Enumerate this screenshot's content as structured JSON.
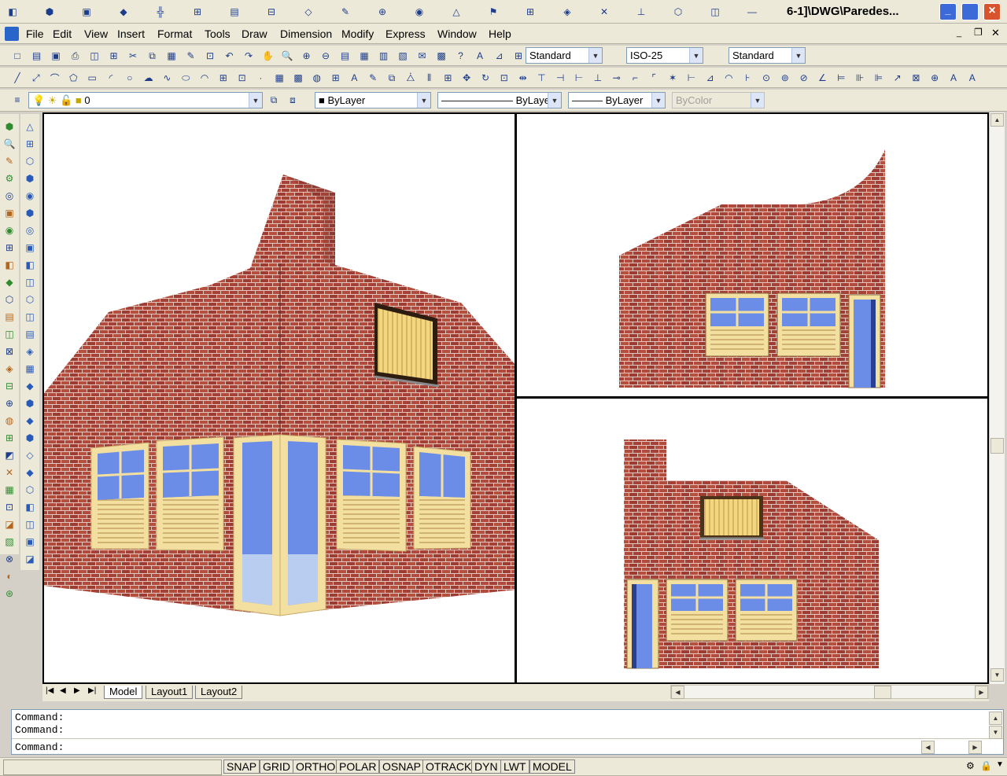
{
  "window": {
    "title": "6-1]\\DWG\\Paredes...",
    "minimize": "_",
    "close": "×"
  },
  "menu": {
    "items": [
      "File",
      "Edit",
      "View",
      "Insert",
      "Format",
      "Tools",
      "Draw",
      "Dimension",
      "Modify",
      "Express",
      "Window",
      "Help"
    ]
  },
  "styles": {
    "text_style": "Standard",
    "dim_style": "ISO-25",
    "table_style": "Standard"
  },
  "layers": {
    "current_layer": "0",
    "color": "ByLayer",
    "linetype": "ByLayer",
    "lineweight": "ByLayer",
    "plot_style": "ByColor"
  },
  "tabs": [
    "Model",
    "Layout1",
    "Layout2"
  ],
  "command": {
    "lines": [
      "Command:",
      "Command:",
      "Command:"
    ]
  },
  "status": {
    "buttons": [
      "SNAP",
      "GRID",
      "ORTHO",
      "POLAR",
      "OSNAP",
      "OTRACK",
      "DYN",
      "LWT",
      "MODEL"
    ]
  },
  "colors": {
    "brick": "#a8453b",
    "mortar": "#e3c6be",
    "frame": "#f2dc98",
    "glass": "#6b8de8"
  }
}
